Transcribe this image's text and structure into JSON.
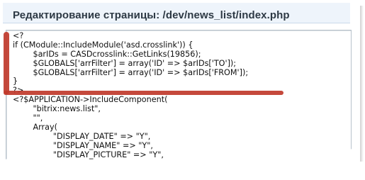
{
  "window": {
    "title": "Редактирование страницы: /dev/news_list/index.php"
  },
  "editor": {
    "lines": [
      "<?",
      "if (CModule::IncludeModule('asd.crosslink')) {",
      "        $arIDs = CASDcrosslink::GetLinks(19856);",
      "        $GLOBALS['arrFilter'] = array('ID' => $arIDs['TO']);",
      "        $GLOBALS['arrFilter'] = array('ID' => $arIDs['FROM']);",
      "}",
      "?>",
      "<?$APPLICATION->IncludeComponent(",
      "        \"bitrix:news.list\",",
      "        \"\",",
      "        Array(",
      "                \"DISPLAY_DATE\" => \"Y\",",
      "                \"DISPLAY_NAME\" => \"Y\",",
      "                \"DISPLAY_PICTURE\" => \"Y\","
    ]
  },
  "highlight": {
    "color": "#c0392b"
  }
}
